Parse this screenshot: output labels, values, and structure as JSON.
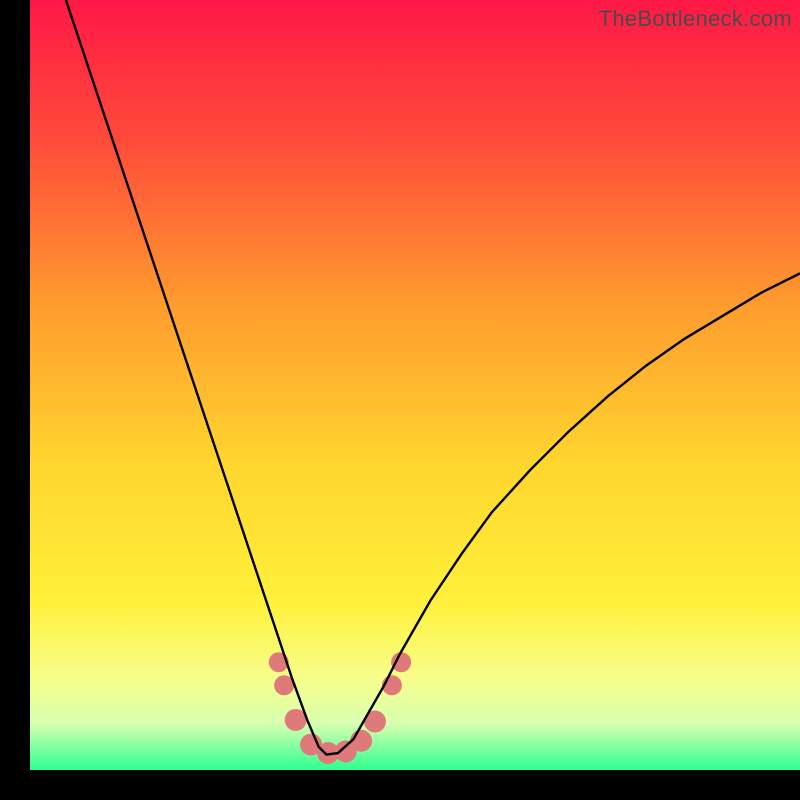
{
  "watermark": "TheBottleneck.com",
  "chart_data": {
    "type": "line",
    "title": "",
    "xlabel": "",
    "ylabel": "",
    "xlim": [
      0,
      100
    ],
    "ylim": [
      0,
      100
    ],
    "grid": false,
    "legend": false,
    "background_gradient": {
      "top": "#ff1846",
      "mid_upper": "#ff9d2e",
      "mid": "#ffe92e",
      "lower": "#f7ff8a",
      "bottom": "#2eff90"
    },
    "series": [
      {
        "name": "curve",
        "stroke": "#000000",
        "x": [
          4,
          6,
          8,
          10,
          12,
          14,
          16,
          18,
          20,
          22,
          24,
          26,
          28,
          30,
          32,
          34,
          36,
          37.5,
          38.5,
          40,
          42,
          44,
          46,
          48,
          52,
          56,
          60,
          65,
          70,
          75,
          80,
          85,
          90,
          95,
          100
        ],
        "y": [
          102,
          96,
          90,
          84,
          78,
          72,
          66,
          60,
          54,
          48,
          42,
          36,
          30,
          24,
          18,
          12,
          6.5,
          3,
          2,
          2.2,
          4,
          7.5,
          11,
          15,
          22,
          28,
          33.5,
          39,
          44,
          48.5,
          52.5,
          56,
          59,
          62,
          64.5
        ]
      }
    ],
    "marker_cluster": {
      "color": "#e07a7a",
      "points": [
        {
          "x": 32.3,
          "y": 14.0,
          "r": 10
        },
        {
          "x": 33.0,
          "y": 11.0,
          "r": 10
        },
        {
          "x": 34.5,
          "y": 6.5,
          "r": 11
        },
        {
          "x": 36.5,
          "y": 3.3,
          "r": 11
        },
        {
          "x": 38.7,
          "y": 2.2,
          "r": 11
        },
        {
          "x": 41.0,
          "y": 2.4,
          "r": 11
        },
        {
          "x": 43.0,
          "y": 3.8,
          "r": 11
        },
        {
          "x": 44.8,
          "y": 6.3,
          "r": 11
        },
        {
          "x": 47.0,
          "y": 11.0,
          "r": 10
        },
        {
          "x": 48.2,
          "y": 14.0,
          "r": 10
        }
      ]
    }
  }
}
